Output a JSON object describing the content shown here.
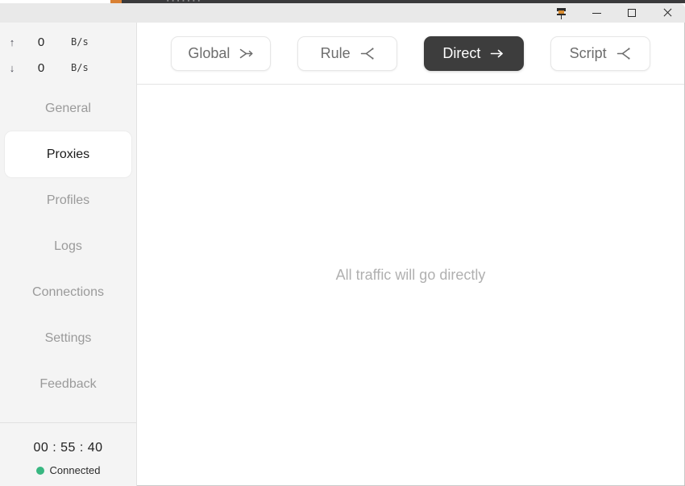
{
  "window": {
    "background_strip_ghost_text": "▪ ▪ ▪ ▪ ▪ ▪ ▪",
    "controls": {
      "pin_label": "Pin",
      "minimize_label": "Minimize",
      "maximize_label": "Maximize",
      "close_label": "Close"
    }
  },
  "sidebar": {
    "speed": {
      "upload": {
        "icon": "arrow-up-icon",
        "arrow": "↑",
        "value": "0",
        "unit": "B/s"
      },
      "download": {
        "icon": "arrow-down-icon",
        "arrow": "↓",
        "value": "0",
        "unit": "B/s"
      }
    },
    "items": [
      {
        "label": "General",
        "active": false
      },
      {
        "label": "Proxies",
        "active": true
      },
      {
        "label": "Profiles",
        "active": false
      },
      {
        "label": "Logs",
        "active": false
      },
      {
        "label": "Connections",
        "active": false
      },
      {
        "label": "Settings",
        "active": false
      },
      {
        "label": "Feedback",
        "active": false
      }
    ],
    "status": {
      "timer": "00 : 55 : 40",
      "connection_label": "Connected",
      "connection_color": "#38b781"
    }
  },
  "toolbar": {
    "modes": [
      {
        "label": "Global",
        "icon": "arrow-merge-icon",
        "active": false
      },
      {
        "label": "Rule",
        "icon": "branch-icon",
        "active": false
      },
      {
        "label": "Direct",
        "icon": "arrow-right-icon",
        "active": true
      },
      {
        "label": "Script",
        "icon": "branch-icon",
        "active": false
      }
    ]
  },
  "main": {
    "empty_message": "All traffic will go directly"
  },
  "colors": {
    "active_mode_bg": "#3d3d3d",
    "sidebar_bg": "#f4f4f4",
    "titlebar_bg": "#e9e9e9",
    "muted_text": "#9a9a9a",
    "connected_green": "#38b781"
  }
}
